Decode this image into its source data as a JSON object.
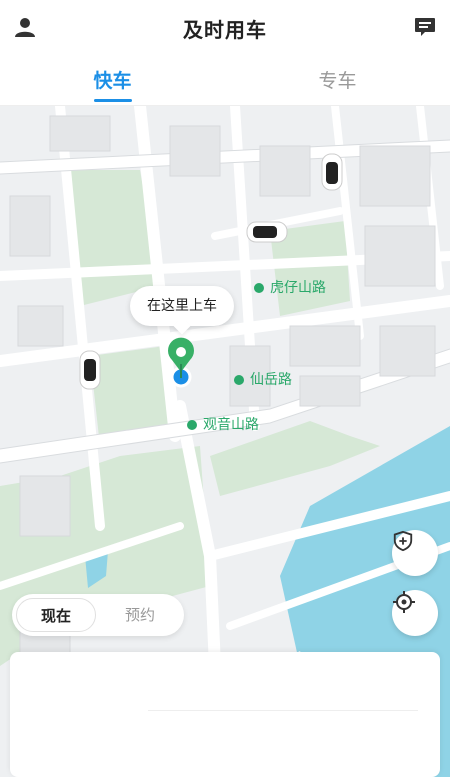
{
  "header": {
    "title": "及时用车",
    "profile_icon": "person-icon",
    "message_icon": "message-icon"
  },
  "tabs": [
    {
      "label": "快车",
      "active": true
    },
    {
      "label": "专车",
      "active": false
    }
  ],
  "map": {
    "pickup_bubble": "在这里上车",
    "streets": [
      {
        "label": "虎仔山路"
      },
      {
        "label": "仙岳路"
      },
      {
        "label": "观音山路"
      }
    ],
    "cars": 3
  },
  "ride_time": {
    "options": [
      {
        "label": "现在",
        "active": true
      },
      {
        "label": "预约",
        "active": false
      }
    ]
  },
  "controls": {
    "safety_icon": "shield-plus-icon",
    "locate_icon": "locate-crosshair-icon"
  },
  "colors": {
    "accent": "#1b8fe6",
    "street_label": "#2aa86a",
    "pin": "#38b067",
    "water": "#8fd3e6"
  }
}
